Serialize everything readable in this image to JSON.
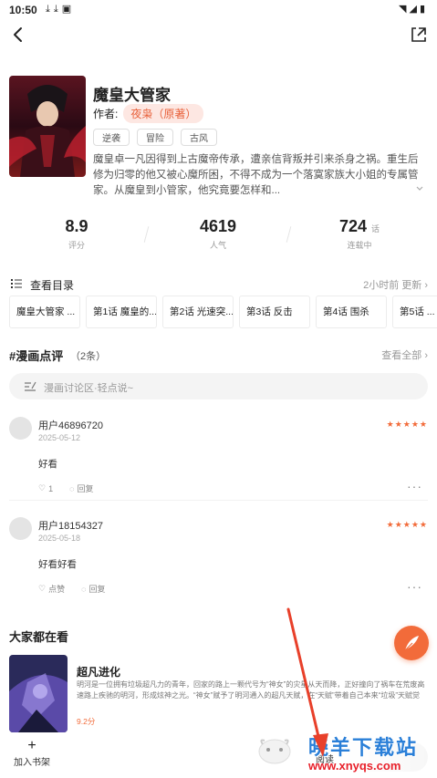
{
  "status_bar": {
    "time": "10:50",
    "icons": [
      "download-icon",
      "download-icon",
      "app-icon"
    ],
    "right_icons": [
      "wifi-icon",
      "signal-icon",
      "battery-icon"
    ]
  },
  "book": {
    "title": "魔皇大管家",
    "author_label": "作者:",
    "author": "夜枭（原著）",
    "tags": [
      "逆袭",
      "冒险",
      "古风"
    ],
    "description": "魔皇卓一凡因得到上古魔帝传承，遭亲信背叛并引来杀身之祸。重生后修为归零的他又被心魔所困，不得不成为一个落寞家族大小姐的专属管家。从魔皇到小管家，他究竟要怎样和..."
  },
  "stats": [
    {
      "value": "8.9",
      "unit": "",
      "label": "评分"
    },
    {
      "value": "4619",
      "unit": "",
      "label": "人气"
    },
    {
      "value": "724",
      "unit": "话",
      "label": "连载中"
    }
  ],
  "catalog": {
    "label": "查看目录",
    "update": "2小时前 更新 ›"
  },
  "chapters": [
    "魔皇大管家 ...",
    "第1话 魔皇的...",
    "第2话 光速突...",
    "第3话 反击",
    "第4话 围杀",
    "第5话 ..."
  ],
  "reviews_section": {
    "title": "#漫画点评",
    "count": "（2条）",
    "view_all": "查看全部 ›",
    "input_placeholder": "漫画讨论区·轻点说~"
  },
  "reviews": [
    {
      "user": "用户46896720",
      "date": "2025-05-12",
      "stars": "★★★★★",
      "text": "好看",
      "likes": "1",
      "reply": "回复",
      "more": "···"
    },
    {
      "user": "用户18154327",
      "date": "2025-05-18",
      "stars": "★★★★★",
      "text": "好看好看",
      "likes": "点赞",
      "reply": "回复",
      "more": "···"
    }
  ],
  "recommend": {
    "section_title": "大家都在看",
    "title": "超凡进化",
    "description": "明河是一位拥有垃圾超凡力的青年，回家的路上一颗代号为“神女”的灾星从天而降，正好撞向了祸车在荒废高速路上疾驰的明河，形成炫神之光。“神女”赋予了明河通入的超凡天赋，在“天赋”带着自己本来“垃圾”天赋觉醒...",
    "score": "9.2分"
  },
  "bottom": {
    "shelf": "加入书架",
    "read": "阅读"
  },
  "watermark": {
    "text": "晓羊下载站",
    "url": "www.xnyqs.com"
  },
  "colors": {
    "accent": "#f26b3a",
    "author_bg": "#fde7e2"
  }
}
